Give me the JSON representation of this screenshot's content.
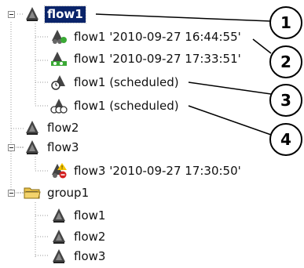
{
  "tree": {
    "items": [
      {
        "label": "flow1",
        "icon": "flow-icon",
        "selected": true
      },
      {
        "label": "flow1 '2010-09-27 16:44:55'",
        "icon": "flow-run-success-icon"
      },
      {
        "label": "flow1 '2010-09-27 17:33:51'",
        "icon": "flow-run-green-icon"
      },
      {
        "label": "flow1 (scheduled)",
        "icon": "flow-scheduled-icon"
      },
      {
        "label": "flow1 (scheduled)",
        "icon": "flow-scheduled-repeat-icon"
      },
      {
        "label": "flow2",
        "icon": "flow-icon"
      },
      {
        "label": "flow3",
        "icon": "flow-icon"
      },
      {
        "label": "flow3 '2010-09-27 17:30:50'",
        "icon": "flow-run-error-icon"
      },
      {
        "label": "group1",
        "icon": "folder-icon"
      },
      {
        "label": "flow1",
        "icon": "flow-icon"
      },
      {
        "label": "flow2",
        "icon": "flow-icon"
      },
      {
        "label": "flow3",
        "icon": "flow-icon"
      }
    ]
  },
  "callouts": [
    "1",
    "2",
    "3",
    "4"
  ],
  "colors": {
    "selection": "#0a246a",
    "connector": "#9a9a9a",
    "success": "#3aa935",
    "error": "#d42020",
    "warning": "#f4c400"
  }
}
